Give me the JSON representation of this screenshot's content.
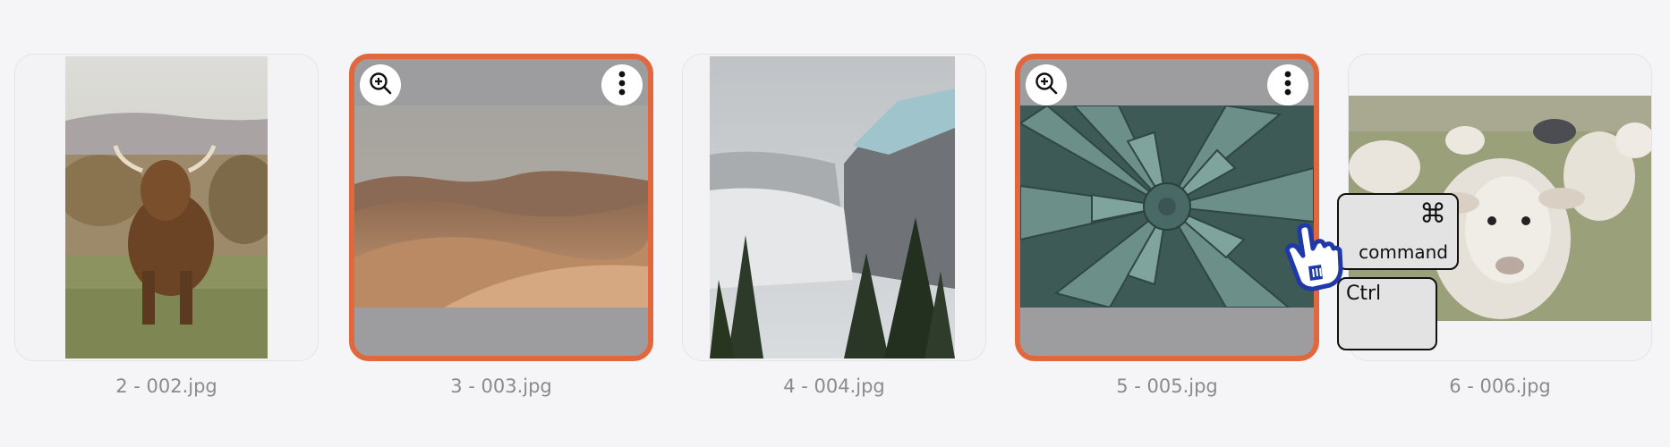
{
  "gallery": {
    "items": [
      {
        "caption": "2 - 002.jpg",
        "subject": "highland cow",
        "selected": false
      },
      {
        "caption": "3 - 003.jpg",
        "subject": "desert dunes",
        "selected": true
      },
      {
        "caption": "4 - 004.jpg",
        "subject": "snowy mountain",
        "selected": false
      },
      {
        "caption": "5 - 005.jpg",
        "subject": "agave succulent",
        "selected": true
      },
      {
        "caption": "6 - 006.jpg",
        "subject": "sheep",
        "selected": false
      }
    ],
    "overlay_icons": {
      "zoom": "zoom-in-icon",
      "more": "more-vertical-icon"
    }
  },
  "keyboard_hint": {
    "command_glyph": "⌘",
    "command_label": "command",
    "ctrl_label": "Ctrl"
  },
  "cursor": {
    "icon": "hand-pointer-icon"
  },
  "colors": {
    "selection_border": "#e2673d",
    "background": "#f5f5f7",
    "caption_text": "#8b8b8f"
  }
}
